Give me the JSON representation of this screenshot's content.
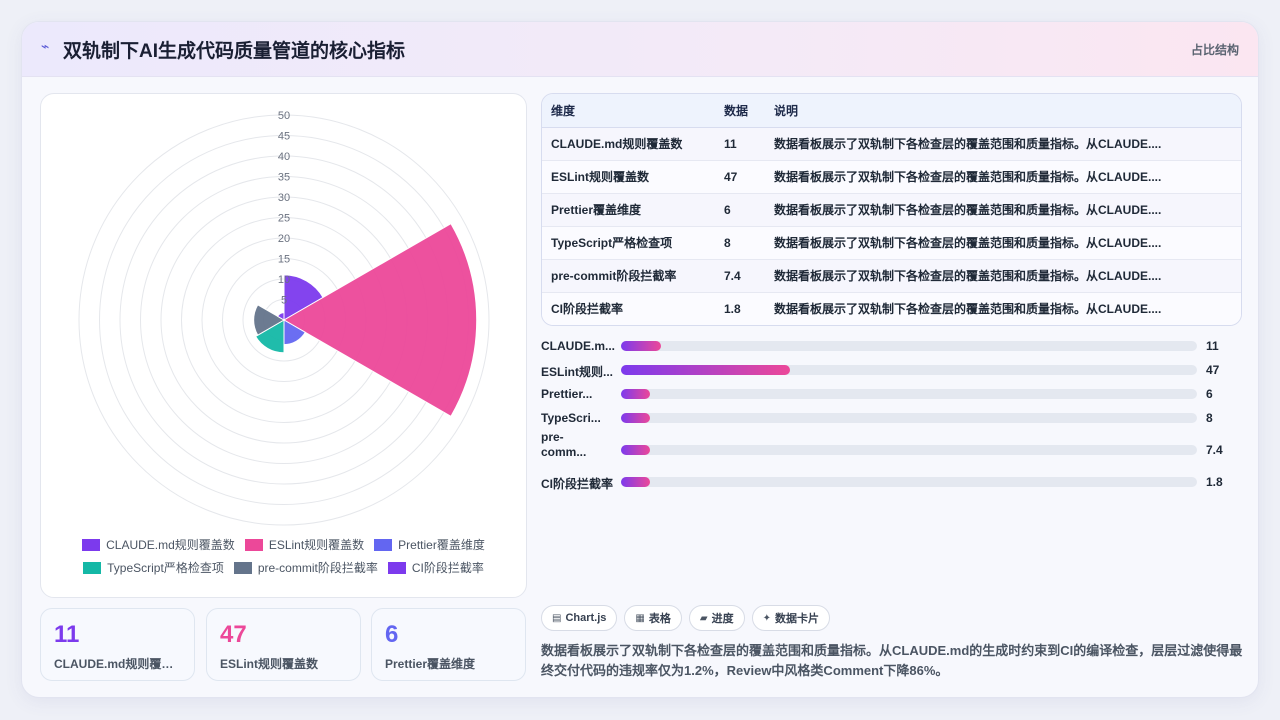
{
  "header": {
    "icon": "chart-icon",
    "title": "双轨制下AI生成代码质量管道的核心指标",
    "badge": "占比结构"
  },
  "chart_data": {
    "type": "polarArea",
    "categories": [
      "CLAUDE.md规则覆盖数",
      "ESLint规则覆盖数",
      "Prettier覆盖维度",
      "TypeScript严格检查项",
      "pre-commit阶段拦截率",
      "CI阶段拦截率"
    ],
    "values": [
      11,
      47,
      6,
      8,
      7.4,
      1.8
    ],
    "colors": [
      "#7c3aed",
      "#ec4899",
      "#6366f1",
      "#14b8a6",
      "#64748b",
      "#7c3aed"
    ],
    "rlim": [
      0,
      50
    ],
    "ticks": [
      5,
      10,
      15,
      20,
      25,
      30,
      35,
      40,
      45,
      50
    ],
    "legend_position": "bottom",
    "grid": true
  },
  "legend": [
    {
      "label": "CLAUDE.md规则覆盖数",
      "color": "#7c3aed"
    },
    {
      "label": "ESLint规则覆盖数",
      "color": "#ec4899"
    },
    {
      "label": "Prettier覆盖维度",
      "color": "#6366f1"
    },
    {
      "label": "TypeScript严格检查项",
      "color": "#14b8a6"
    },
    {
      "label": "pre-commit阶段拦截率",
      "color": "#64748b"
    },
    {
      "label": "CI阶段拦截率",
      "color": "#7c3aed"
    }
  ],
  "kpis": [
    {
      "value": "11",
      "label": "CLAUDE.md规则覆盖数",
      "color": "#7c3aed"
    },
    {
      "value": "47",
      "label": "ESLint规则覆盖数",
      "color": "#ec4899"
    },
    {
      "value": "6",
      "label": "Prettier覆盖维度",
      "color": "#6366f1"
    }
  ],
  "table": {
    "headers": [
      "维度",
      "数据",
      "说明"
    ],
    "rows": [
      [
        "CLAUDE.md规则覆盖数",
        "11",
        "数据看板展示了双轨制下各检查层的覆盖范围和质量指标。从CLAUDE...."
      ],
      [
        "ESLint规则覆盖数",
        "47",
        "数据看板展示了双轨制下各检查层的覆盖范围和质量指标。从CLAUDE...."
      ],
      [
        "Prettier覆盖维度",
        "6",
        "数据看板展示了双轨制下各检查层的覆盖范围和质量指标。从CLAUDE...."
      ],
      [
        "TypeScript严格检查项",
        "8",
        "数据看板展示了双轨制下各检查层的覆盖范围和质量指标。从CLAUDE...."
      ],
      [
        "pre-commit阶段拦截率",
        "7.4",
        "数据看板展示了双轨制下各检查层的覆盖范围和质量指标。从CLAUDE...."
      ],
      [
        "CI阶段拦截率",
        "1.8",
        "数据看板展示了双轨制下各检查层的覆盖范围和质量指标。从CLAUDE...."
      ]
    ]
  },
  "progress": {
    "max": 47,
    "items": [
      {
        "label": "CLAUDE.m...",
        "value": 11,
        "display": "11"
      },
      {
        "label": "ESLint规则...",
        "value": 47,
        "display": "47"
      },
      {
        "label": "Prettier...",
        "value": 6,
        "display": "6"
      },
      {
        "label": "TypeScri...",
        "value": 8,
        "display": "8"
      },
      {
        "label": "pre-comm...",
        "value": 7.4,
        "display": "7.4"
      },
      {
        "label": "CI阶段拦截率",
        "value": 1.8,
        "display": "1.8"
      }
    ]
  },
  "tags": [
    {
      "icon": "▤",
      "icon_name": "chart-icon",
      "label": "Chart.js"
    },
    {
      "icon": "▦",
      "icon_name": "table-icon",
      "label": "表格"
    },
    {
      "icon": "▰",
      "icon_name": "progress-icon",
      "label": "进度"
    },
    {
      "icon": "✦",
      "icon_name": "sparkle-icon",
      "label": "数据卡片"
    }
  ],
  "description": "数据看板展示了双轨制下各检查层的覆盖范围和质量指标。从CLAUDE.md的生成时约束到CI的编译检查，层层过滤使得最终交付代码的违规率仅为1.2%，Review中风格类Comment下降86%。"
}
